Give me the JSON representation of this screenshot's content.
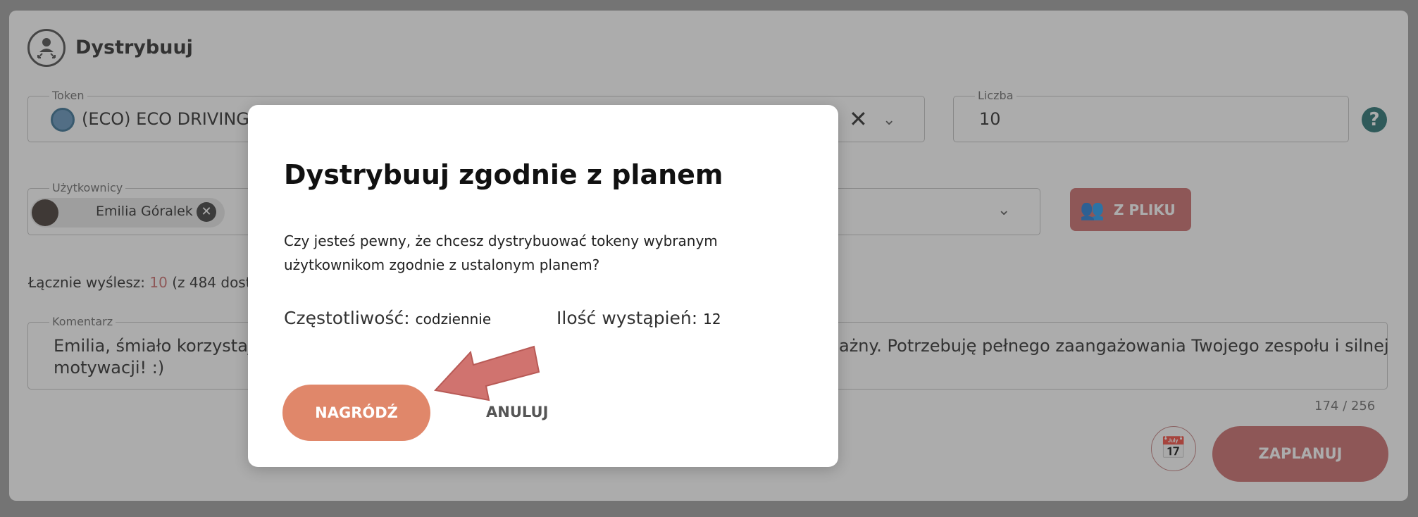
{
  "header": {
    "title": "Dystrybuuj",
    "icon": "distribute-user-icon"
  },
  "token_field": {
    "label": "Token",
    "value": "(ECO) ECO DRIVING"
  },
  "amount_field": {
    "label": "Liczba",
    "value": "10"
  },
  "users_field": {
    "label": "Użytkownicy",
    "chip_name": "Emilia Góralek"
  },
  "from_file_button": {
    "label": "Z PLIKU"
  },
  "total": {
    "prefix": "Łącznie wyślesz:",
    "amount": "10",
    "rest": "(z 484 dost"
  },
  "comment_field": {
    "label": "Komentarz",
    "line1_start": "Emilia, śmiało korzystaj z",
    "line1_end": "ażny. Potrzebuję pełnego zaangażowania Twojego zespołu i silnej",
    "line2": "motywacji! :)",
    "counter": "174 / 256"
  },
  "schedule_button": {
    "label": "ZAPLANUJ"
  },
  "modal": {
    "title": "Dystrybuuj zgodnie z planem",
    "body": "Czy jesteś pewny, że chcesz dystrybuować tokeny wybranym użytkownikom zgodnie z ustalonym planem?",
    "frequency_label": "Częstotliwość:",
    "frequency_value": "codziennie",
    "occurrences_label": "Ilość wystąpień:",
    "occurrences_value": "12",
    "confirm_label": "NAGRÓDŹ",
    "cancel_label": "ANULUJ"
  },
  "colors": {
    "accent": "#c86565",
    "confirm": "#e0876a",
    "arrow": "#d0736f",
    "help": "#1d6b6b"
  }
}
